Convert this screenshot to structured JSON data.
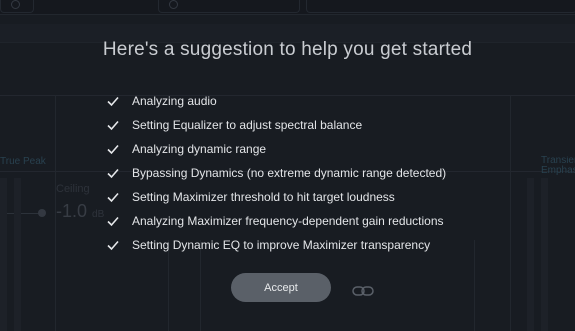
{
  "background": {
    "ceiling_label": "Ceiling",
    "ceiling_value": "-1.0",
    "ceiling_unit": "dB",
    "left_panel_label": "True Peak",
    "right_panel_label": "Transient Emphasis"
  },
  "suggestion": {
    "title": "Here's a suggestion to help you get started",
    "steps": [
      "Analyzing audio",
      "Setting Equalizer to adjust spectral balance",
      "Analyzing dynamic range",
      "Bypassing Dynamics (no extreme dynamic range detected)",
      "Setting Maximizer threshold to hit target loudness",
      "Analyzing Maximizer frequency-dependent gain reductions",
      "Setting Dynamic EQ to improve Maximizer transparency"
    ],
    "accept_label": "Accept",
    "icons": {
      "step": "check-icon",
      "link": "link-icon"
    }
  }
}
